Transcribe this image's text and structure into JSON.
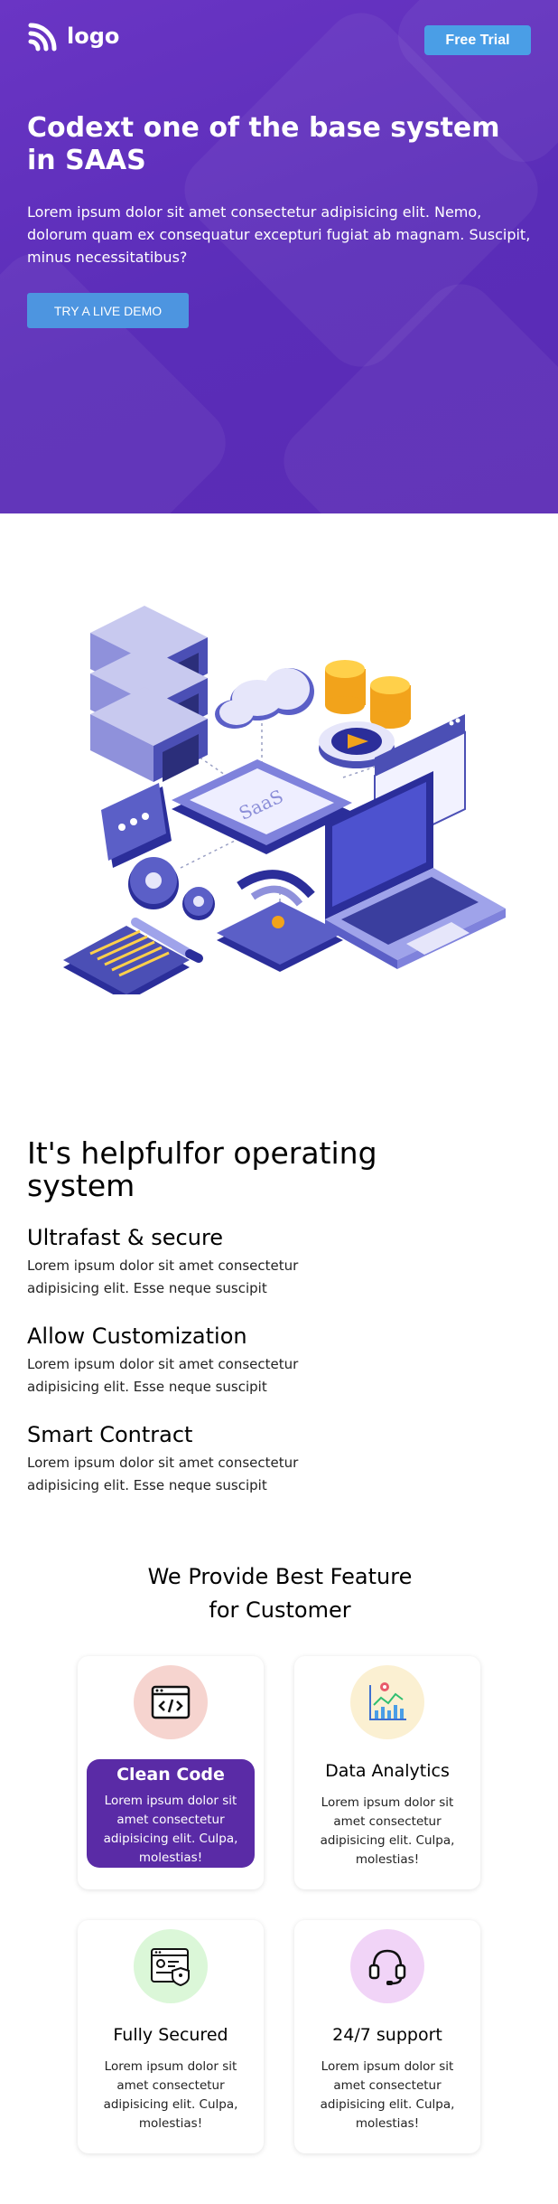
{
  "header": {
    "logo_text": "logo",
    "trial_button": "Free Trial"
  },
  "hero": {
    "title": "Codext one of the base system in SAAS",
    "text": "Lorem ipsum dolor sit amet consectetur adipisicing elit. Nemo, dolorum quam ex consequatur excepturi fugiat ab magnam. Suscipit, minus necessitatibus?",
    "cta": "TRY A LIVE DEMO"
  },
  "illustration": {
    "label": "SaaS"
  },
  "features": {
    "title": "It's helpfulfor operating system",
    "items": [
      {
        "title": "Ultrafast & secure",
        "text": "Lorem ipsum dolor sit amet consectetur adipisicing elit. Esse neque suscipit"
      },
      {
        "title": "Allow Customization",
        "text": "Lorem ipsum dolor sit amet consectetur adipisicing elit. Esse neque suscipit"
      },
      {
        "title": "Smart Contract",
        "text": "Lorem ipsum dolor sit amet consectetur adipisicing elit. Esse neque suscipit"
      }
    ]
  },
  "provide": {
    "title_line1": "We Provide Best Feature",
    "title_line2": "for Customer",
    "cards": [
      {
        "title": "Clean Code",
        "text": "Lorem ipsum dolor sit amet consectetur adipisicing elit. Culpa, molestias!",
        "icon": "code-window-icon",
        "circle_color": "#f6d4cf"
      },
      {
        "title": "Data Analytics",
        "text": "Lorem ipsum dolor sit amet consectetur adipisicing elit. Culpa, molestias!",
        "icon": "analytics-chart-icon",
        "circle_color": "#fbf0d2"
      },
      {
        "title": "Fully Secured",
        "text": "Lorem ipsum dolor sit amet consectetur adipisicing elit. Culpa, molestias!",
        "icon": "secure-document-icon",
        "circle_color": "#dbf7d8"
      },
      {
        "title": "24/7 support",
        "text": "Lorem ipsum dolor sit amet consectetur adipisicing elit. Culpa, molestias!",
        "icon": "headset-icon",
        "circle_color": "#f1d4f7"
      }
    ]
  },
  "colors": {
    "hero_bg": "#5d2fb9",
    "button_blue": "#4a9ee6",
    "active_card": "#5a2ba6"
  }
}
